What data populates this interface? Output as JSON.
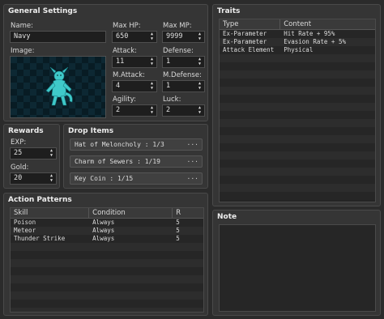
{
  "general": {
    "title": "General Settings",
    "name_label": "Name:",
    "name_value": "Navy",
    "image_label": "Image:",
    "maxhp_label": "Max HP:",
    "maxhp_value": "650",
    "maxmp_label": "Max MP:",
    "maxmp_value": "9999",
    "attack_label": "Attack:",
    "attack_value": "11",
    "defense_label": "Defense:",
    "defense_value": "1",
    "mattack_label": "M.Attack:",
    "mattack_value": "4",
    "mdefense_label": "M.Defense:",
    "mdefense_value": "1",
    "agility_label": "Agility:",
    "agility_value": "2",
    "luck_label": "Luck:",
    "luck_value": "2"
  },
  "rewards": {
    "title": "Rewards",
    "exp_label": "EXP:",
    "exp_value": "25",
    "gold_label": "Gold:",
    "gold_value": "20"
  },
  "drops": {
    "title": "Drop Items",
    "items": [
      "Hat of Meloncholy : 1/3",
      "Charm of Sewers : 1/19",
      "Key Coin : 1/15"
    ],
    "more": "···"
  },
  "actions": {
    "title": "Action Patterns",
    "headers": [
      "Skill",
      "Condition",
      "R"
    ],
    "rows": [
      [
        "Poison",
        "Always",
        "5"
      ],
      [
        "Meteor",
        "Always",
        "5"
      ],
      [
        "Thunder Strike",
        "Always",
        "5"
      ]
    ]
  },
  "traits": {
    "title": "Traits",
    "headers": [
      "Type",
      "Content"
    ],
    "rows": [
      [
        "Ex-Parameter",
        "Hit Rate + 95%"
      ],
      [
        "Ex-Parameter",
        "Evasion Rate + 5%"
      ],
      [
        "Attack Element",
        "Physical"
      ]
    ]
  },
  "note": {
    "title": "Note"
  },
  "colors": {
    "background": "#2b2b2b",
    "panel": "#353535",
    "field": "#1e1e1e",
    "sprite": "#3fc9c9"
  }
}
